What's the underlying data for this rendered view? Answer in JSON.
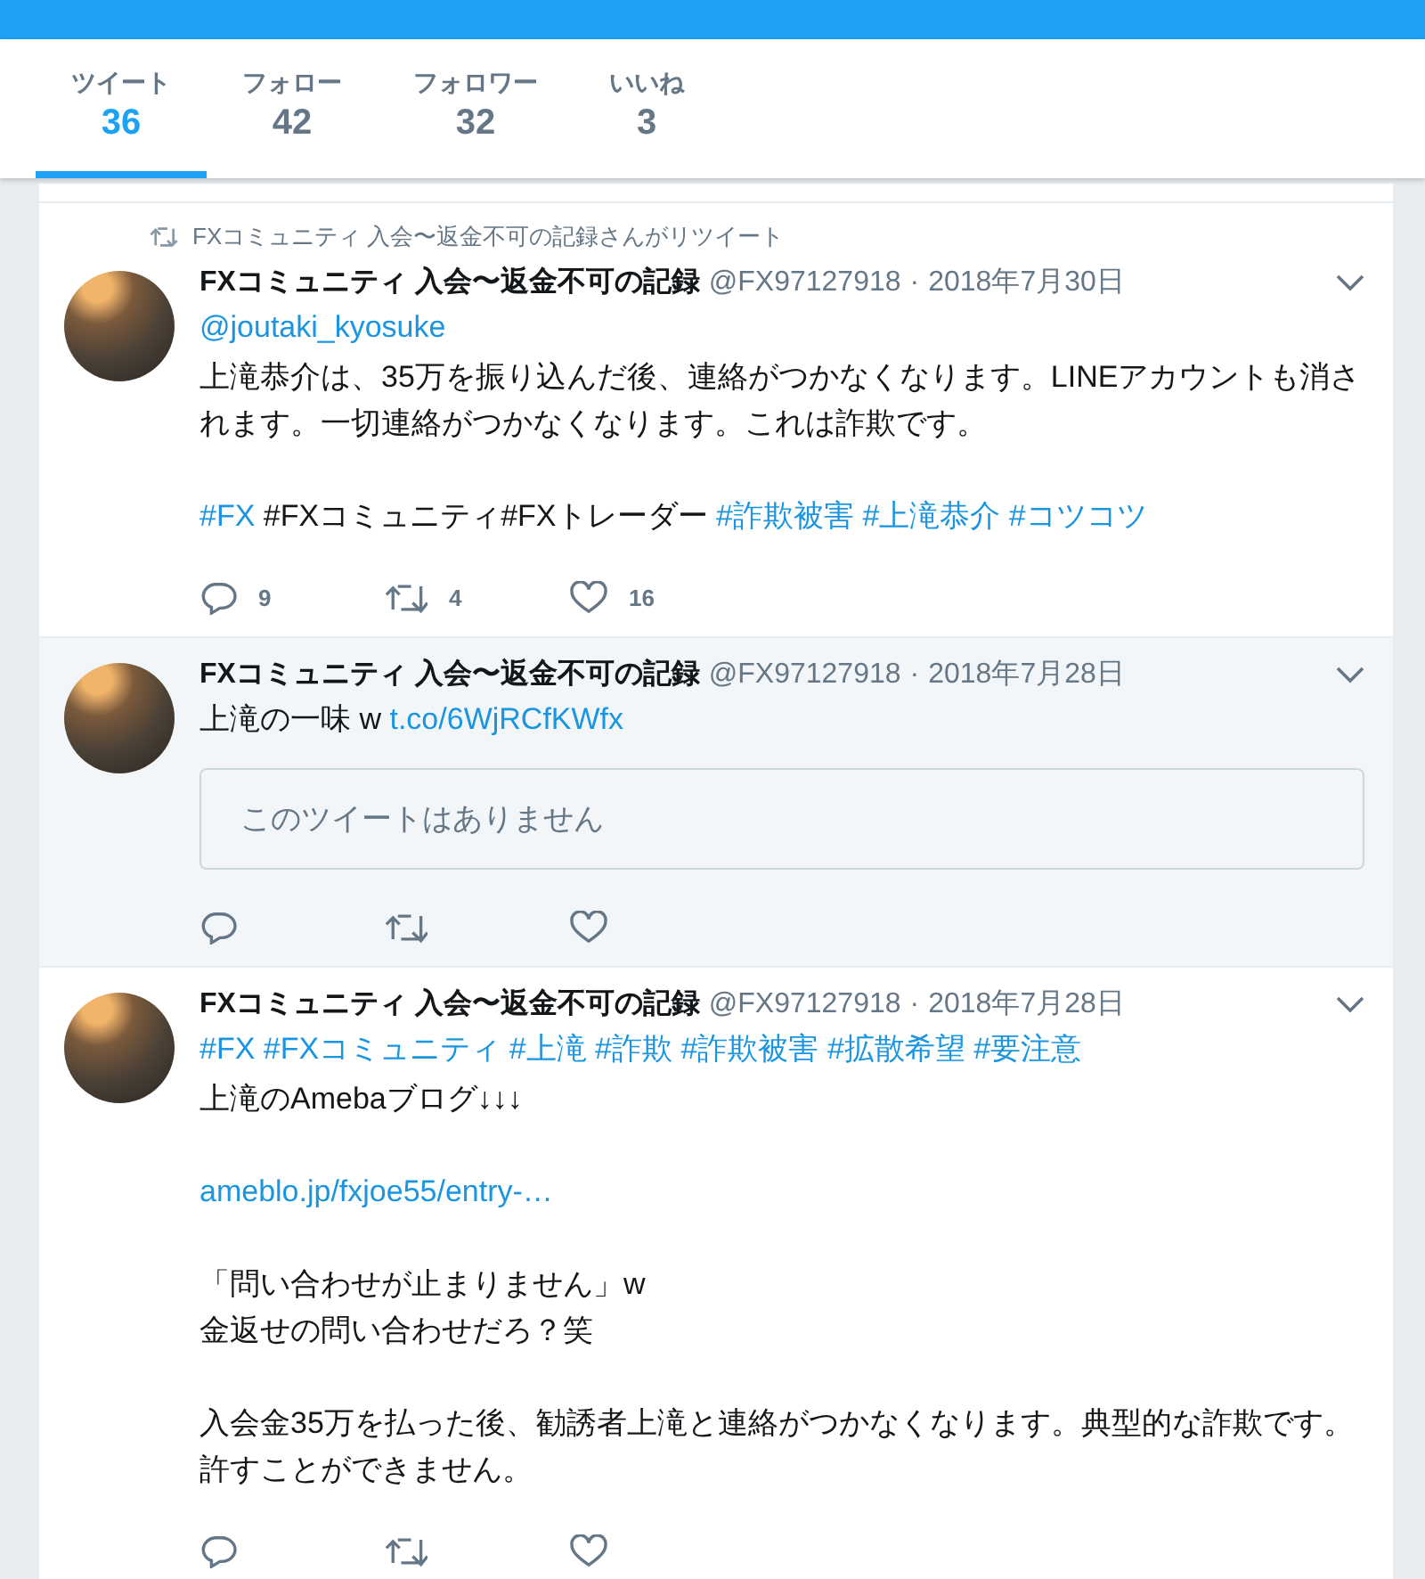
{
  "tabs": [
    {
      "label": "ツイート",
      "count": "36",
      "selected": true
    },
    {
      "label": "フォロー",
      "count": "42",
      "selected": false
    },
    {
      "label": "フォロワー",
      "count": "32",
      "selected": false
    },
    {
      "label": "いいね",
      "count": "3",
      "selected": false
    }
  ],
  "tweets": [
    {
      "highlighted": false,
      "retweet_note": "FXコミュニティ 入会〜返金不可の記録さんがリツイート",
      "name": "FXコミュニティ 入会〜返金不可の記録",
      "handle": "@FX97127918",
      "separator": "·",
      "date": "2018年7月30日",
      "paragraphs": [
        [
          {
            "kind": "link",
            "text": "@joutaki_kyosuke"
          }
        ],
        [
          {
            "kind": "text",
            "text": "上滝恭介は、35万を振り込んだ後、連絡がつかなくなります。LINEアカウントも消されます。一切連絡がつかなくなります。これは詐欺です。"
          }
        ],
        [
          {
            "kind": "link",
            "text": "#FX"
          },
          {
            "kind": "text",
            "text": " #FXコミュニティ#FXトレーダー "
          },
          {
            "kind": "link",
            "text": "#詐欺被害"
          },
          {
            "kind": "link",
            "text": "#上滝恭介"
          },
          {
            "kind": "link",
            "text": "#コツコツ"
          }
        ]
      ],
      "actions": [
        {
          "kind": "reply",
          "count": "9"
        },
        {
          "kind": "retweet",
          "count": "4"
        },
        {
          "kind": "like",
          "count": "16"
        }
      ]
    },
    {
      "highlighted": true,
      "name": "FXコミュニティ 入会〜返金不可の記録",
      "handle": "@FX97127918",
      "separator": "·",
      "date": "2018年7月28日",
      "paragraphs": [
        [
          {
            "kind": "text",
            "text": "上滝の一味 w "
          },
          {
            "kind": "link",
            "text": "t.co/6WjRCfKWfx"
          }
        ]
      ],
      "quote": "このツイートはありません",
      "actions": [
        {
          "kind": "reply"
        },
        {
          "kind": "retweet"
        },
        {
          "kind": "like"
        }
      ]
    },
    {
      "highlighted": false,
      "name": "FXコミュニティ 入会〜返金不可の記録",
      "handle": "@FX97127918",
      "separator": "·",
      "date": "2018年7月28日",
      "paragraphs": [
        [
          {
            "kind": "link",
            "text": "#FX"
          },
          {
            "kind": "link",
            "text": "#FXコミュニティ"
          },
          {
            "kind": "link",
            "text": "#上滝"
          },
          {
            "kind": "link",
            "text": "#詐欺"
          },
          {
            "kind": "link",
            "text": "#詐欺被害"
          },
          {
            "kind": "link",
            "text": "#拡散希望"
          },
          {
            "kind": "link",
            "text": "#要注意"
          }
        ],
        [
          {
            "kind": "text",
            "text": "上滝のAmebaブログ↓↓↓"
          }
        ],
        [
          {
            "kind": "link",
            "text": "ameblo.jp/fxjoe55/entry-…"
          }
        ],
        [
          {
            "kind": "text",
            "text": "「問い合わせが止まりません」w\n金返せの問い合わせだろ？笑"
          }
        ],
        [
          {
            "kind": "text",
            "text": "入会金35万を払った後、勧誘者上滝と連絡がつかなくなります。典型的な詐欺です。許すことができません。"
          }
        ]
      ],
      "actions": [
        {
          "kind": "reply"
        },
        {
          "kind": "retweet"
        },
        {
          "kind": "like"
        }
      ]
    }
  ]
}
